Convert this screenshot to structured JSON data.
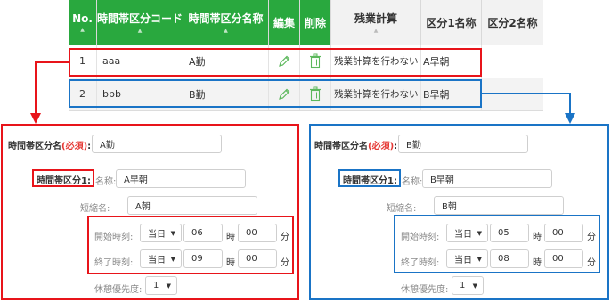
{
  "table": {
    "headers": {
      "no": "No.",
      "code": "時間帯区分コード",
      "name": "時間帯区分名称",
      "edit": "編集",
      "delete": "削除",
      "overtime": "残業計算",
      "category1": "区分1名称",
      "category2": "区分2名称"
    },
    "rows": [
      {
        "no": "1",
        "code": "aaa",
        "name": "A勤",
        "overtime": "残業計算を行わない",
        "category1": "A早朝",
        "category2": ""
      },
      {
        "no": "2",
        "code": "bbb",
        "name": "B勤",
        "overtime": "残業計算を行わない",
        "category1": "B早朝",
        "category2": ""
      }
    ]
  },
  "panels": [
    {
      "name_label": "時間帯区分名",
      "required": "(必須)",
      "colon": ":",
      "name_value": "A勤",
      "section_label": "時間帯区分1:",
      "sub_name_label": "名称:",
      "sub_name_value": "A早朝",
      "short_label": "短縮名:",
      "short_value": "A朝",
      "start_label": "開始時刻:",
      "start_day": "当日",
      "start_hour": "06",
      "start_min": "00",
      "end_label": "終了時刻:",
      "end_day": "当日",
      "end_hour": "09",
      "end_min": "00",
      "hour_unit": "時",
      "min_unit": "分",
      "priority_label": "休憩優先度:",
      "priority_value": "1"
    },
    {
      "name_label": "時間帯区分名",
      "required": "(必須)",
      "colon": ":",
      "name_value": "B勤",
      "section_label": "時間帯区分1:",
      "sub_name_label": "名称:",
      "sub_name_value": "B早朝",
      "short_label": "短縮名:",
      "short_value": "B朝",
      "start_label": "開始時刻:",
      "start_day": "当日",
      "start_hour": "05",
      "start_min": "00",
      "end_label": "終了時刻:",
      "end_day": "当日",
      "end_hour": "08",
      "end_min": "00",
      "hour_unit": "時",
      "min_unit": "分",
      "priority_label": "休憩優先度:",
      "priority_value": "1"
    }
  ],
  "icons": {
    "edit": "pencil-icon",
    "delete": "trash-icon",
    "sort": "sort-caret-icon",
    "dropdown": "caret-down-icon"
  },
  "colors": {
    "header_green": "#29a83e",
    "highlight_red": "#e8141a",
    "highlight_blue": "#1a74c6",
    "required_red": "#e53935",
    "icon_green": "#4caf50"
  }
}
